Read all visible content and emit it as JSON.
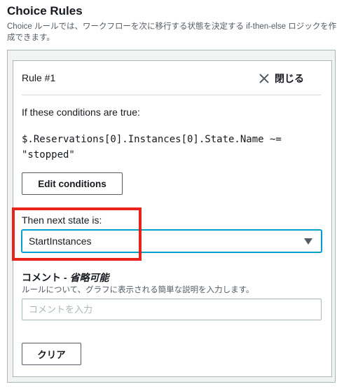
{
  "section": {
    "title": "Choice Rules",
    "description": "Choice ルールでは、ワークフローを次に移行する状態を決定する if-then-else ロジックを作成できます。"
  },
  "rule": {
    "title": "Rule #1",
    "close_label": "閉じる",
    "conditions_label": "If these conditions are true:",
    "condition_expression": "$.Reservations[0].Instances[0].State.Name ~=\n\"stopped\"",
    "edit_button_label": "Edit conditions",
    "next_state_label": "Then next state is:",
    "next_state_value": "StartInstances",
    "comment": {
      "label": "コメント - ",
      "optional_label": "省略可能",
      "help_text": "ルールについて、グラフに表示される簡単な説明を入力します。",
      "placeholder": "コメントを入力",
      "value": ""
    },
    "clear_button_label": "クリア"
  },
  "icons": {
    "close": "close-x-icon",
    "dropdown": "caret-down-icon"
  },
  "colors": {
    "highlight": "#e8231c",
    "focus_border": "#00a1c9",
    "panel_background": "#f2f3f3"
  }
}
